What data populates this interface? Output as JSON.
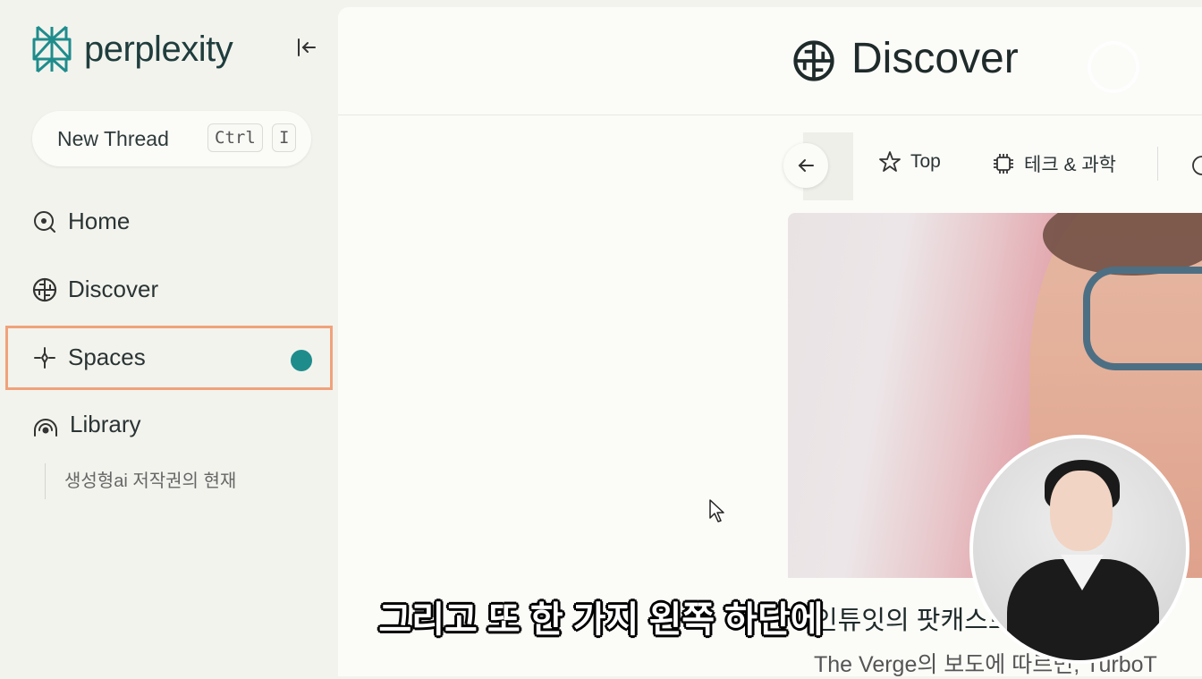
{
  "sidebar": {
    "brand": "perplexity",
    "new_thread_label": "New Thread",
    "shortcut_keys": [
      "Ctrl",
      "I"
    ],
    "items": [
      {
        "label": "Home",
        "icon": "home-icon"
      },
      {
        "label": "Discover",
        "icon": "discover-icon"
      },
      {
        "label": "Spaces",
        "icon": "spaces-icon",
        "highlighted": true
      },
      {
        "label": "Library",
        "icon": "library-icon"
      }
    ],
    "library_items": [
      "생성형ai 저작권의 현재"
    ],
    "accent_color": "#1f8c8c",
    "highlight_color": "#f0a27a"
  },
  "header": {
    "title": "Discover"
  },
  "tabs": [
    {
      "label": "Top",
      "icon": "star-icon"
    },
    {
      "label": "테크 & 과학",
      "icon": "chip-icon"
    }
  ],
  "card": {
    "title": "인튜잇의 팟캐스트",
    "subtitle": "The Verge의 보도에 따르면, TurboT"
  },
  "caption": "그리고 또 한 가지 왼쪽 하단에"
}
